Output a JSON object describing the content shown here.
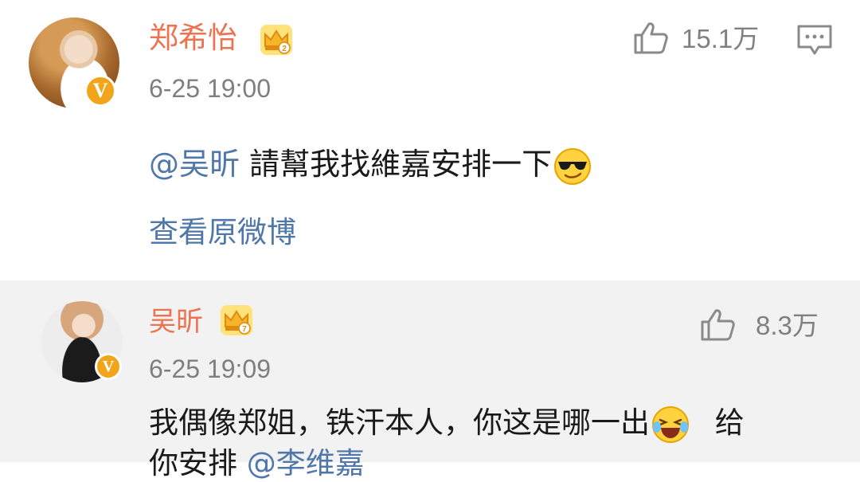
{
  "comments": [
    {
      "username": "郑希怡",
      "crown_icon": "vip-crown-icon",
      "verified_icon": "verified-v-badge-icon",
      "timestamp": "6-25 19:00",
      "like_icon": "thumbs-up-icon",
      "likes": "15.1万",
      "reply_icon": "comment-bubble-icon",
      "mention": "@吴昕",
      "text": "請幫我找維嘉安排一下",
      "emoji": "sunglasses-smile-emoji",
      "view_original": "查看原微博"
    },
    {
      "username": "吴昕",
      "crown_icon": "vip-crown-icon",
      "verified_icon": "verified-v-badge-icon",
      "timestamp": "6-25 19:09",
      "like_icon": "thumbs-up-icon",
      "likes": "8.3万",
      "line1_text": "我偶像郑姐，铁汗本人，你这是哪一出",
      "line1_emoji": "laugh-cry-emoji",
      "line1_tail": "给",
      "line2_text": "你安排",
      "line2_mention": "@李维嘉"
    }
  ],
  "colors": {
    "username": "#eb7350",
    "link": "#5077aa",
    "meta": "#7f7f7f",
    "verified_badge": "#f2a51a",
    "reply_background": "#f2f2f2"
  }
}
